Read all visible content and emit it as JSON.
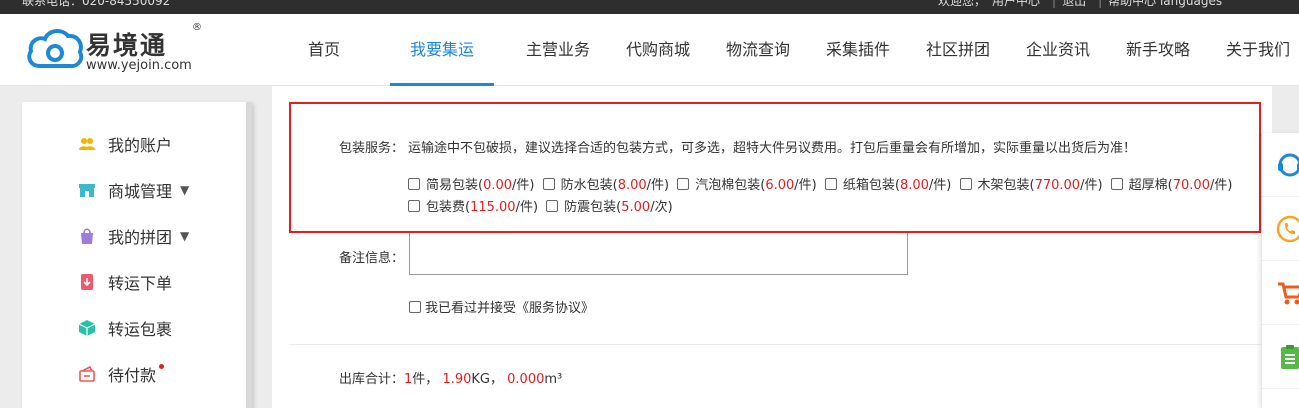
{
  "topbar": {
    "left_text": "联系电话：020-84550092",
    "welcome": "欢迎您，",
    "user_center": "用户中心",
    "logout": "退出",
    "help_languages": "帮助中心 languages"
  },
  "logo": {
    "brand": "易境通",
    "reg_mark": "®",
    "url": "www.yejoin.com",
    "brand_color": "#1e88d8"
  },
  "nav": {
    "items": [
      {
        "label": "首页",
        "active": false
      },
      {
        "label": "我要集运",
        "active": true
      },
      {
        "label": "主营业务",
        "active": false
      },
      {
        "label": "代购商城",
        "active": false
      },
      {
        "label": "物流查询",
        "active": false
      },
      {
        "label": "采集插件",
        "active": false
      },
      {
        "label": "社区拼团",
        "active": false
      },
      {
        "label": "企业资讯",
        "active": false
      },
      {
        "label": "新手攻略",
        "active": false
      },
      {
        "label": "关于我们",
        "active": false
      }
    ]
  },
  "sidebar": {
    "items": [
      {
        "label": "我的账户",
        "icon": "user-group-icon"
      },
      {
        "label": "商城管理",
        "icon": "store-icon",
        "dropdown": true
      },
      {
        "label": "我的拼团",
        "icon": "group-bag-icon",
        "dropdown": true
      },
      {
        "label": "转运下单",
        "icon": "order-icon"
      },
      {
        "label": "转运包裹",
        "icon": "package-icon"
      },
      {
        "label": "待付款",
        "icon": "payment-icon",
        "badge": true
      }
    ]
  },
  "packaging": {
    "label": "包装服务：",
    "description": "运输途中不包破损，建议选择合适的包装方式，可多选，超特大件另议费用。打包后重量会有所增加，实际重量以出货后为准！",
    "options": [
      {
        "name": "简易包装(",
        "price": "0.00",
        "unit": "/件)"
      },
      {
        "name": "防水包装(",
        "price": "8.00",
        "unit": "/件)"
      },
      {
        "name": "汽泡棉包装(",
        "price": "6.00",
        "unit": "/件)"
      },
      {
        "name": "纸箱包装(",
        "price": "8.00",
        "unit": "/件)"
      },
      {
        "name": "木架包装(",
        "price": "770.00",
        "unit": "/件)"
      },
      {
        "name": "超厚棉(",
        "price": "70.00",
        "unit": "/件)"
      },
      {
        "name": "包装费(",
        "price": "115.00",
        "unit": "/件)"
      },
      {
        "name": "防震包装(",
        "price": "5.00",
        "unit": "/次)"
      }
    ]
  },
  "remark": {
    "label": "备注信息：",
    "value": ""
  },
  "agreement": {
    "text": "我已看过并接受《服务协议》"
  },
  "summary": {
    "label": "出库合计：",
    "count": "1",
    "count_unit": "件，",
    "weight": "1.90",
    "weight_unit": "KG，",
    "volume": "0.000",
    "volume_unit": "m³"
  },
  "floatbar": {
    "items": [
      "customer-service-icon",
      "phone-icon",
      "cart-icon",
      "clipboard-icon"
    ]
  },
  "colors": {
    "accent": "#1e88d8",
    "highlight_border": "#e02020",
    "price": "#e02020"
  }
}
